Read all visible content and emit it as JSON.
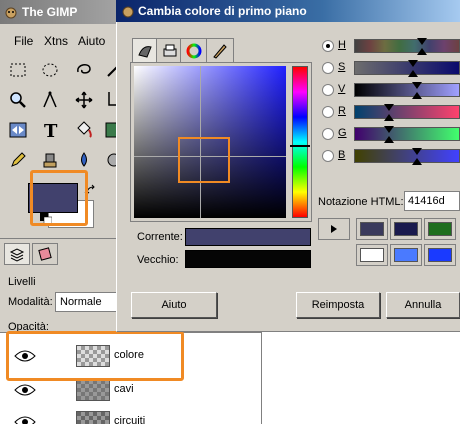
{
  "toolbox": {
    "title": "The GIMP",
    "menu": [
      "File",
      "Xtns",
      "Aiuto"
    ],
    "tools": [
      "rect-select",
      "ellipse-select",
      "lasso",
      "fuzzy-select",
      "color-picker",
      "path",
      "move",
      "crop",
      "flip",
      "text",
      "bucket-fill",
      "gradient",
      "pencil",
      "clone",
      "smudge"
    ],
    "fg_color": "#41416d",
    "bg_color": "#ffffff"
  },
  "layers": {
    "label": "Livelli",
    "mode_label": "Modalità:",
    "mode_value": "Normale",
    "opacity_label": "Opacità:",
    "items": [
      {
        "name": "colore"
      },
      {
        "name": "cavi"
      },
      {
        "name": "circuiti"
      }
    ]
  },
  "dialog": {
    "title": "Cambia colore di primo piano",
    "current_label": "Corrente:",
    "old_label": "Vecchio:",
    "current_color": "#41416d",
    "old_color": "#050505",
    "channels": [
      {
        "label": "H",
        "selected": true
      },
      {
        "label": "S",
        "selected": false
      },
      {
        "label": "V",
        "selected": false
      },
      {
        "label": "R",
        "selected": false
      },
      {
        "label": "G",
        "selected": false
      },
      {
        "label": "B",
        "selected": false
      }
    ],
    "html_label": "Notazione HTML:",
    "html_value": "41416d",
    "history_colors": [
      "#3a3a5c",
      "#1a1a4e",
      "#1e6e1e",
      "#ffffff",
      "#4a7aff",
      "#1a3aff"
    ],
    "help_label": "Aiuto",
    "reset_label": "Reimposta",
    "cancel_label": "Annulla"
  }
}
